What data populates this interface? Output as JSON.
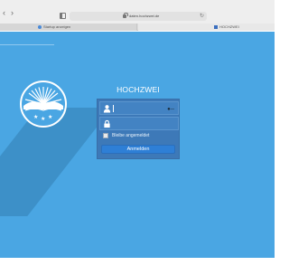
{
  "browser": {
    "url": "daten.hochzwei.de",
    "tabs": [
      {
        "label": "Startup anzeigen"
      },
      {
        "label": "HOCHZWEI"
      }
    ]
  },
  "login": {
    "brand": "HOCHZWEI",
    "username_value": "",
    "password_value": "",
    "remember_label": "Bleibe angemeldet",
    "remember_checked": false,
    "submit_label": "Anmelden"
  },
  "colors": {
    "background": "#4aa6e3",
    "panel": "#3d79b8",
    "button": "#2e7fd6"
  },
  "icons": [
    "back-icon",
    "forward-icon",
    "sidebar-icon",
    "lock-icon",
    "reload-icon",
    "user-icon",
    "password-lock-icon",
    "key-icon",
    "sun-logo-icon"
  ]
}
